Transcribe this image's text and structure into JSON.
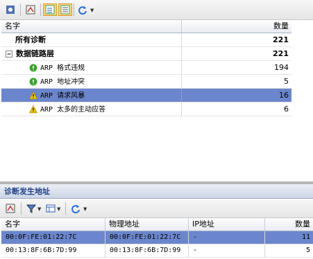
{
  "top_grid": {
    "col_name": "名字",
    "col_count": "数量",
    "rows": [
      {
        "label": "所有诊断",
        "count": "221",
        "bold": true,
        "icon": "none"
      },
      {
        "label": "数据链路层",
        "count": "221",
        "bold": true,
        "icon": "collapse-minus-icon"
      },
      {
        "label": "ARP 格式违规",
        "count": "194",
        "icon": "ok-green-icon"
      },
      {
        "label": "ARP 地址冲突",
        "count": "5",
        "icon": "ok-green-icon"
      },
      {
        "label": "ARP 请求风暴",
        "count": "16",
        "icon": "warning-icon",
        "selected": true
      },
      {
        "label": "ARP 太多的主动应答",
        "count": "6",
        "icon": "warning-icon"
      }
    ]
  },
  "lower_panel": {
    "title": "诊断发生地址",
    "columns": [
      "名字",
      "物理地址",
      "IP地址",
      "数量"
    ],
    "rows": [
      {
        "name": "00:0F:FE:01:22:7C",
        "mac": "00:0F:FE:01:22:7C",
        "ip": "-",
        "count": "11",
        "selected": true
      },
      {
        "name": "00:13:8F:6B:7D:99",
        "mac": "00:13:8F:6B:7D:99",
        "ip": "-",
        "count": "5"
      }
    ]
  },
  "colors": {
    "selection": "#6b86cc",
    "panel_title": "#1e3f86"
  }
}
